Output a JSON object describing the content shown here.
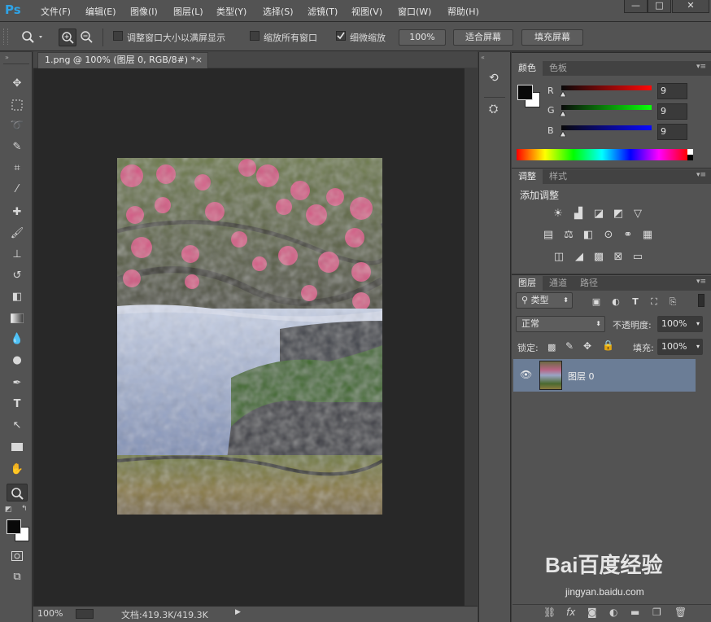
{
  "app": {
    "logo": "Ps"
  },
  "menu": [
    "文件(F)",
    "编辑(E)",
    "图像(I)",
    "图层(L)",
    "类型(Y)",
    "选择(S)",
    "滤镜(T)",
    "视图(V)",
    "窗口(W)",
    "帮助(H)"
  ],
  "window_controls": {
    "minimize": "—",
    "maximize": "□",
    "close": "✕"
  },
  "options": {
    "resize_windows_label": "调整窗口大小以满屏显示",
    "zoom_all_label": "缩放所有窗口",
    "scrubby_zoom_label": "细微缩放",
    "zoom_100_label": "100%",
    "fit_screen_label": "适合屏幕",
    "fill_screen_label": "填充屏幕",
    "resize_windows_checked": false,
    "zoom_all_checked": false,
    "scrubby_zoom_checked": true
  },
  "document": {
    "tab_title": "1.png @ 100% (图层 0, RGB/8#) *",
    "tab_close": "×",
    "status_zoom": "100%",
    "status_doc": "文档:419.3K/419.3K",
    "status_arrow": "▶"
  },
  "color_panel": {
    "tabs": [
      "颜色",
      "色板"
    ],
    "channels": [
      {
        "label": "R",
        "value": "9",
        "color": "#cc2222"
      },
      {
        "label": "G",
        "value": "9",
        "color": "#22bb22"
      },
      {
        "label": "B",
        "value": "9",
        "color": "#2233cc"
      }
    ],
    "foreground": "#090909",
    "background": "#ffffff"
  },
  "adjust_panel": {
    "tabs": [
      "调整",
      "样式"
    ],
    "heading": "添加调整"
  },
  "layers_panel": {
    "tabs": [
      "图层",
      "通道",
      "路径"
    ],
    "filter_label": "类型",
    "blend_mode": "正常",
    "opacity_label": "不透明度:",
    "opacity_value": "100%",
    "lock_label": "锁定:",
    "fill_label": "填充:",
    "fill_value": "100%",
    "layers": [
      {
        "name": "图层 0",
        "visible": true
      }
    ],
    "footer_icons": [
      "link-icon",
      "fx-icon",
      "mask-icon",
      "adjustment-icon",
      "group-icon",
      "new-layer-icon",
      "trash-icon"
    ]
  },
  "watermark": {
    "text": "Bai百度经验",
    "url": "jingyan.baidu.com"
  }
}
